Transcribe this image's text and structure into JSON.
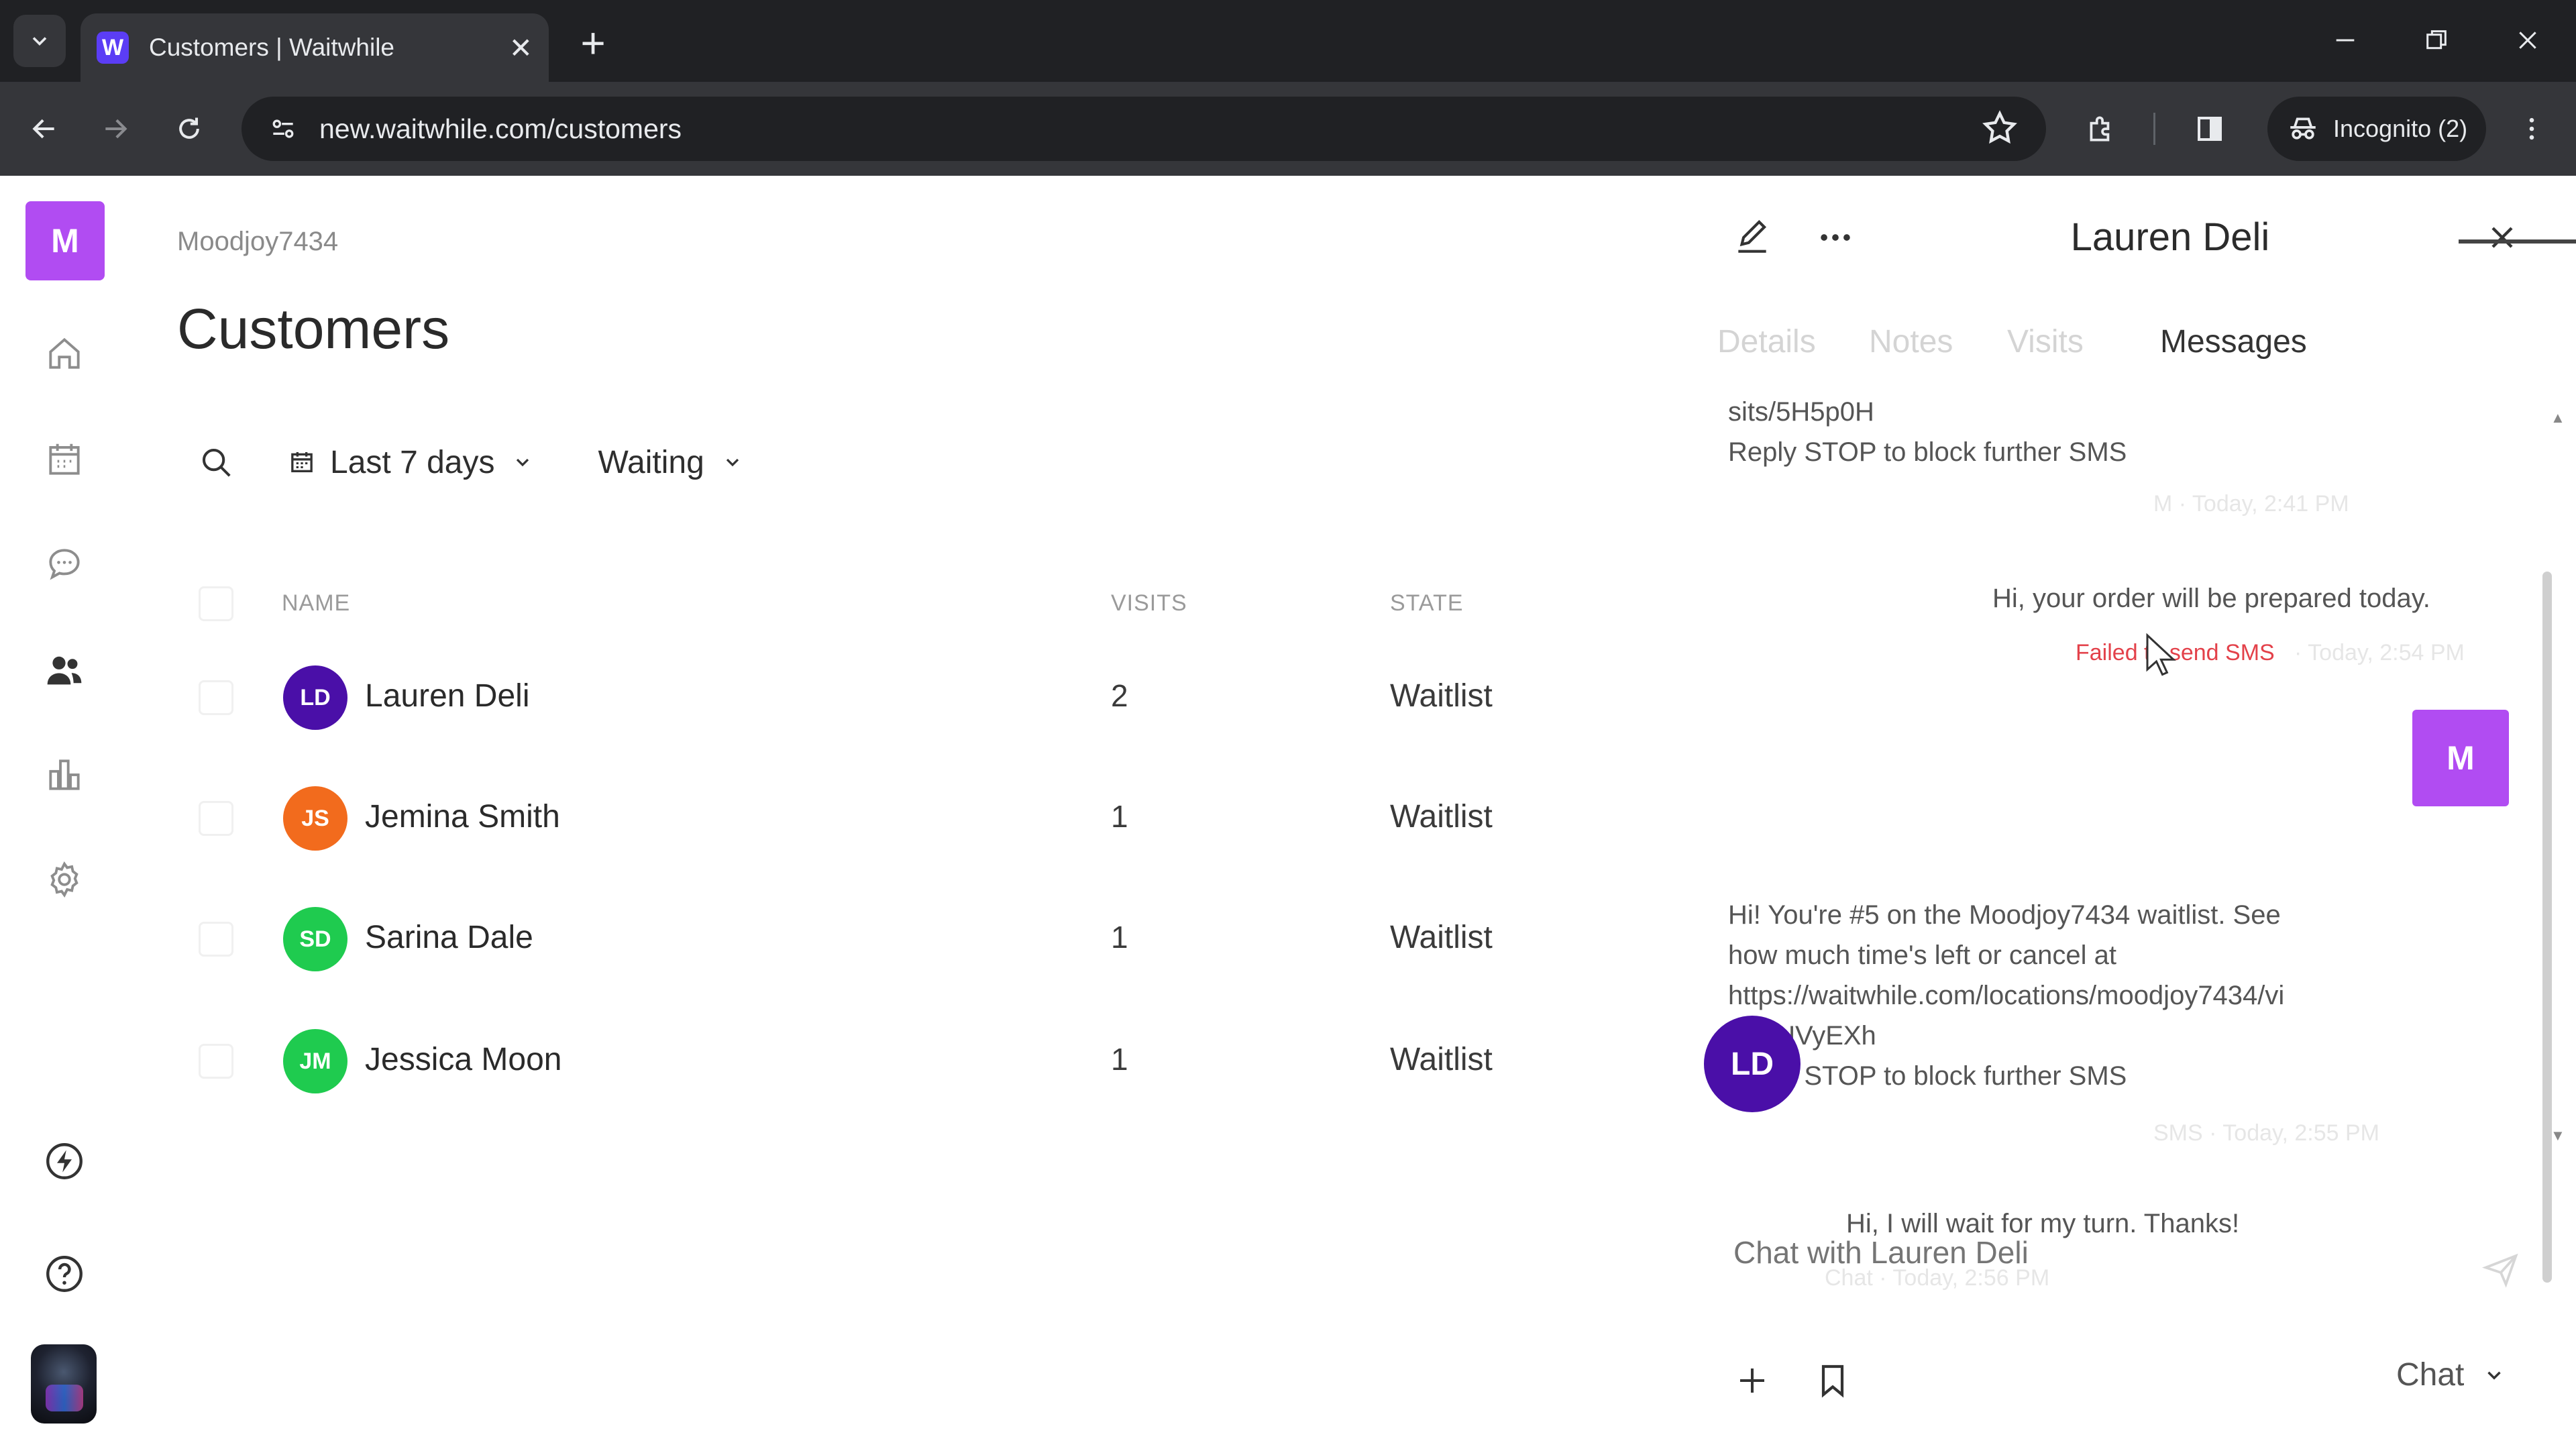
{
  "browser": {
    "tab_title": "Customers | Waitwhile",
    "favicon_letter": "W",
    "url": "new.waitwhile.com/customers",
    "incognito_label": "Incognito (2)"
  },
  "sidebar": {
    "org_initial": "M",
    "items": [
      {
        "icon": "home-icon"
      },
      {
        "icon": "calendar-icon"
      },
      {
        "icon": "chat-bubble-icon"
      },
      {
        "icon": "customers-icon",
        "active": true
      },
      {
        "icon": "analytics-icon"
      },
      {
        "icon": "settings-icon"
      }
    ],
    "bottom": [
      {
        "icon": "lightning-icon"
      },
      {
        "icon": "help-icon"
      }
    ]
  },
  "main": {
    "breadcrumb": "Moodjoy7434",
    "title": "Customers",
    "filters": {
      "date_range": "Last 7 days",
      "state": "Waiting"
    },
    "columns": [
      "NAME",
      "VISITS",
      "STATE"
    ],
    "rows": [
      {
        "initials": "LD",
        "name": "Lauren Deli",
        "visits": "2",
        "state": "Waitlist",
        "color": "#4a0fa8"
      },
      {
        "initials": "JS",
        "name": "Jemina Smith",
        "visits": "1",
        "state": "Waitlist",
        "color": "#f26b1d"
      },
      {
        "initials": "SD",
        "name": "Sarina Dale",
        "visits": "1",
        "state": "Waitlist",
        "color": "#1fcb4f"
      },
      {
        "initials": "JM",
        "name": "Jessica Moon",
        "visits": "1",
        "state": "Waitlist",
        "color": "#1fcb4f"
      }
    ]
  },
  "panel": {
    "title": "Lauren Deli",
    "tabs": [
      "Details",
      "Notes",
      "Visits",
      "Messages"
    ],
    "active_tab": "Messages",
    "messages": {
      "m1_line1": "sits/5H5p0H",
      "m1_line2": "Reply STOP to block further SMS",
      "m1_meta": "M · Today, 2:41 PM",
      "m2_text": "Hi, your order will be prepared today.",
      "m2_status": "Failed to send SMS",
      "m2_meta": " · Today, 2:54 PM",
      "m3_lines": [
        "Hi! You're #5 on the Moodjoy7434 waitlist. See",
        "how much time's left or cancel at",
        "https://waitwhile.com/locations/moodjoy7434/vi",
        "sits/UVyEXh",
        "Reply STOP to block further SMS"
      ],
      "m3_meta": "SMS · Today, 2:55 PM",
      "m3_avatar": "M",
      "m4_text": "Hi, I will wait for my turn. Thanks!",
      "m4_meta": "Chat · Today, 2:56 PM",
      "m4_avatar": "LD"
    },
    "input_placeholder": "Chat with Lauren Deli",
    "channel": "Chat"
  }
}
